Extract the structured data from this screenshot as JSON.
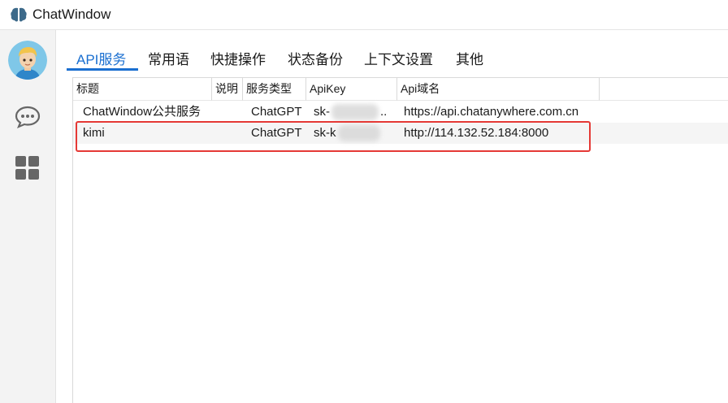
{
  "window": {
    "title": "ChatWindow",
    "app_icon": "brain-icon"
  },
  "sidebar": {
    "avatar": "user-avatar",
    "items": [
      {
        "name": "chat",
        "icon": "chat-bubble-icon"
      },
      {
        "name": "apps",
        "icon": "grid-icon"
      }
    ]
  },
  "tabs": [
    {
      "label": "API服务",
      "active": true
    },
    {
      "label": "常用语",
      "active": false
    },
    {
      "label": "快捷操作",
      "active": false
    },
    {
      "label": "状态备份",
      "active": false
    },
    {
      "label": "上下文设置",
      "active": false
    },
    {
      "label": "其他",
      "active": false
    }
  ],
  "table": {
    "columns": [
      "标题",
      "说明",
      "服务类型",
      "ApiKey",
      "Api域名"
    ],
    "rows": [
      {
        "title": "ChatWindow公共服务",
        "desc": "",
        "type": "ChatGPT",
        "apikey": "sk-",
        "apikey_suffix": "..",
        "domain": "https://api.chatanywhere.com.cn"
      },
      {
        "title": "kimi",
        "desc": "",
        "type": "ChatGPT",
        "apikey": "sk-k",
        "apikey_suffix": "",
        "domain": "http://114.132.52.184:8000"
      }
    ]
  },
  "colors": {
    "accent": "#1a6fd0",
    "highlight": "#e53935",
    "sidebar_bg": "#f3f3f3"
  }
}
